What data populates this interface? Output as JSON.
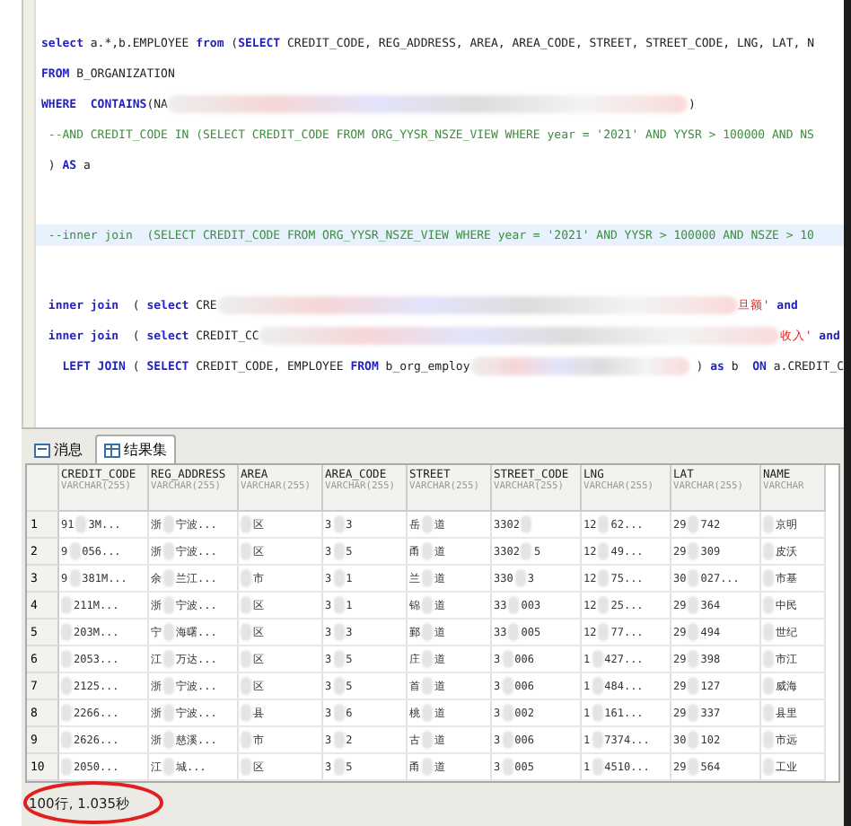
{
  "editor": {
    "lines": [
      {
        "highlighted": false,
        "tokens": [
          {
            "kind": "keyword",
            "text": "select"
          },
          {
            "kind": "plain",
            "text": " a.*,b.EMPLOYEE "
          },
          {
            "kind": "keyword",
            "text": "from"
          },
          {
            "kind": "plain",
            "text": " ("
          },
          {
            "kind": "keyword",
            "text": "SELECT"
          },
          {
            "kind": "plain",
            "text": " CREDIT_CODE, REG_ADDRESS, AREA, AREA_CODE, STREET, STREET_CODE, LNG, LAT, N"
          }
        ]
      },
      {
        "highlighted": false,
        "tokens": [
          {
            "kind": "keyword",
            "text": "FROM"
          },
          {
            "kind": "plain",
            "text": " B_ORGANIZATION"
          }
        ]
      },
      {
        "highlighted": false,
        "tokens": [
          {
            "kind": "keyword",
            "text": "WHERE  CONTAINS"
          },
          {
            "kind": "plain",
            "text": "(NA"
          },
          {
            "kind": "redacted"
          },
          {
            "kind": "plain",
            "text": ")"
          }
        ]
      },
      {
        "highlighted": false,
        "tokens": [
          {
            "kind": "comment",
            "text": " --AND CREDIT_CODE IN (SELECT CREDIT_CODE FROM ORG_YYSR_NSZE_VIEW WHERE year = '2021' AND YYSR > 100000 AND NS"
          }
        ]
      },
      {
        "highlighted": false,
        "tokens": [
          {
            "kind": "plain",
            "text": " ) "
          },
          {
            "kind": "keyword",
            "text": "AS"
          },
          {
            "kind": "plain",
            "text": " a"
          }
        ]
      },
      {
        "highlighted": true,
        "tokens": [
          {
            "kind": "comment",
            "text": " --inner join  (SELECT CREDIT_CODE FROM ORG_YYSR_NSZE_VIEW WHERE year = '2021' AND YYSR > 100000 AND NSZE > 10"
          }
        ]
      },
      {
        "highlighted": false,
        "tokens": [
          {
            "kind": "keyword",
            "text": " inner join"
          },
          {
            "kind": "plain",
            "text": "  ( "
          },
          {
            "kind": "keyword",
            "text": "select"
          },
          {
            "kind": "plain",
            "text": " CRE"
          },
          {
            "kind": "redacted"
          },
          {
            "kind": "string",
            "text": "旦额'"
          },
          {
            "kind": "keyword",
            "text": " and"
          }
        ]
      },
      {
        "highlighted": false,
        "tokens": [
          {
            "kind": "keyword",
            "text": " inner join"
          },
          {
            "kind": "plain",
            "text": "  ( "
          },
          {
            "kind": "keyword",
            "text": "select"
          },
          {
            "kind": "plain",
            "text": " CREDIT_CC"
          },
          {
            "kind": "redacted"
          },
          {
            "kind": "string",
            "text": "收入'"
          },
          {
            "kind": "keyword",
            "text": " and"
          }
        ]
      },
      {
        "highlighted": false,
        "tokens": [
          {
            "kind": "keyword",
            "text": "   LEFT JOIN"
          },
          {
            "kind": "plain",
            "text": " ( "
          },
          {
            "kind": "keyword",
            "text": "SELECT"
          },
          {
            "kind": "plain",
            "text": " CREDIT_CODE, EMPLOYEE "
          },
          {
            "kind": "keyword",
            "text": "FROM"
          },
          {
            "kind": "plain",
            "text": " b_org_employ"
          },
          {
            "kind": "redacted"
          },
          {
            "kind": "plain",
            "text": " ) "
          },
          {
            "kind": "keyword",
            "text": "as"
          },
          {
            "kind": "plain",
            "text": " b  "
          },
          {
            "kind": "keyword",
            "text": "ON"
          },
          {
            "kind": "plain",
            "text": " a.CREDIT_C"
          }
        ]
      }
    ]
  },
  "results": {
    "tabs": [
      {
        "label": "消息",
        "selected": false
      },
      {
        "label": "结果集",
        "selected": true
      }
    ],
    "columns": [
      {
        "name": "CREDIT_CODE",
        "type": "VARCHAR(255)"
      },
      {
        "name": "REG_ADDRESS",
        "type": "VARCHAR(255)"
      },
      {
        "name": "AREA",
        "type": "VARCHAR(255)"
      },
      {
        "name": "AREA_CODE",
        "type": "VARCHAR(255)"
      },
      {
        "name": "STREET",
        "type": "VARCHAR(255)"
      },
      {
        "name": "STREET_CODE",
        "type": "VARCHAR(255)"
      },
      {
        "name": "LNG",
        "type": "VARCHAR(255)"
      },
      {
        "name": "LAT",
        "type": "VARCHAR(255)"
      },
      {
        "name": "NAME",
        "type": "VARCHAR"
      }
    ],
    "rows": [
      {
        "number": "1",
        "cells": [
          [
            "91",
            "3M..."
          ],
          [
            "浙",
            "宁波..."
          ],
          [
            "",
            "区"
          ],
          [
            "3",
            "3"
          ],
          [
            "岳",
            "道"
          ],
          [
            "3302",
            ""
          ],
          [
            "12",
            "62..."
          ],
          [
            "29",
            "742"
          ],
          [
            "",
            "京明"
          ]
        ]
      },
      {
        "number": "2",
        "cells": [
          [
            "9",
            "056..."
          ],
          [
            "浙",
            "宁波..."
          ],
          [
            "",
            "区"
          ],
          [
            "3",
            "5"
          ],
          [
            "甬",
            "道"
          ],
          [
            "3302",
            "5"
          ],
          [
            "12",
            "49..."
          ],
          [
            "29",
            "309"
          ],
          [
            "",
            "皮沃"
          ]
        ]
      },
      {
        "number": "3",
        "cells": [
          [
            "9",
            "381M..."
          ],
          [
            "余",
            "兰江..."
          ],
          [
            "",
            "市"
          ],
          [
            "3",
            "1"
          ],
          [
            "兰",
            "道"
          ],
          [
            "330",
            "3"
          ],
          [
            "12",
            "75..."
          ],
          [
            "30",
            "027..."
          ],
          [
            "",
            "市基"
          ]
        ]
      },
      {
        "number": "4",
        "cells": [
          [
            "",
            "211M..."
          ],
          [
            "浙",
            "宁波..."
          ],
          [
            "",
            "区"
          ],
          [
            "3",
            "1"
          ],
          [
            "锦",
            "道"
          ],
          [
            "33",
            "003"
          ],
          [
            "12",
            "25..."
          ],
          [
            "29",
            "364"
          ],
          [
            "",
            "中民"
          ]
        ]
      },
      {
        "number": "5",
        "cells": [
          [
            "",
            "203M..."
          ],
          [
            "宁",
            "海曙..."
          ],
          [
            "",
            "区"
          ],
          [
            "3",
            "3"
          ],
          [
            "鄞",
            "道"
          ],
          [
            "33",
            "005"
          ],
          [
            "12",
            "77..."
          ],
          [
            "29",
            "494"
          ],
          [
            "",
            "世纪"
          ]
        ]
      },
      {
        "number": "6",
        "cells": [
          [
            "",
            "2053..."
          ],
          [
            "江",
            "万达..."
          ],
          [
            "",
            "区"
          ],
          [
            "3",
            "5"
          ],
          [
            "庄",
            "道"
          ],
          [
            "3",
            "006"
          ],
          [
            "1",
            "427..."
          ],
          [
            "29",
            "398"
          ],
          [
            "",
            "市江"
          ]
        ]
      },
      {
        "number": "7",
        "cells": [
          [
            "",
            "2125..."
          ],
          [
            "浙",
            "宁波..."
          ],
          [
            "",
            "区"
          ],
          [
            "3",
            "5"
          ],
          [
            "首",
            "道"
          ],
          [
            "3",
            "006"
          ],
          [
            "1",
            "484..."
          ],
          [
            "29",
            "127"
          ],
          [
            "",
            "威海"
          ]
        ]
      },
      {
        "number": "8",
        "cells": [
          [
            "",
            "2266..."
          ],
          [
            "浙",
            "宁波..."
          ],
          [
            "",
            "县"
          ],
          [
            "3",
            "6"
          ],
          [
            "桃",
            "道"
          ],
          [
            "3",
            "002"
          ],
          [
            "1",
            "161..."
          ],
          [
            "29",
            "337"
          ],
          [
            "",
            "县里"
          ]
        ]
      },
      {
        "number": "9",
        "cells": [
          [
            "",
            "2626..."
          ],
          [
            "浙",
            "慈溪..."
          ],
          [
            "",
            "市"
          ],
          [
            "3",
            "2"
          ],
          [
            "古",
            "道"
          ],
          [
            "3",
            "006"
          ],
          [
            "1",
            "7374..."
          ],
          [
            "30",
            "102"
          ],
          [
            "",
            "市远"
          ]
        ]
      },
      {
        "number": "10",
        "cells": [
          [
            "",
            "2050..."
          ],
          [
            "江",
            "城..."
          ],
          [
            "",
            "区"
          ],
          [
            "3",
            "5"
          ],
          [
            "甬",
            "道"
          ],
          [
            "3",
            "005"
          ],
          [
            "1",
            "4510..."
          ],
          [
            "29",
            "564"
          ],
          [
            "",
            "工业"
          ]
        ]
      }
    ]
  },
  "status": {
    "text": "100行, 1.035秒",
    "circled": true
  }
}
